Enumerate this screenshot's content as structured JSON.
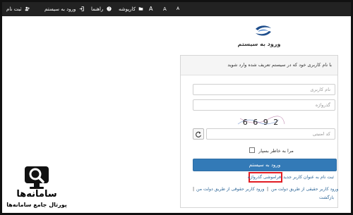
{
  "topbar": {
    "register": "ثبت نام",
    "login": "ورود به سیستم",
    "help": "راهنما",
    "kartabl": "کارپوشه",
    "font_a_1": "A",
    "font_a_2": "A",
    "font_a_3": "A"
  },
  "login": {
    "title": "ورود به سیستم",
    "panel_heading": "با نام کاربری خود که در سیستم تعریف شده وارد شوید",
    "username_placeholder": "نام کاربری",
    "password_placeholder": "گذرواژه",
    "captcha_text": "6 6 9 2",
    "security_code_placeholder": "کد امنیتی",
    "remember_label": "مرا به خاطر بسپار",
    "submit_label": "ورود به سیستم",
    "forgot_password": "فراموشی گذرواژه",
    "register_new_user": "ثبت نام به عنوان کاربر جدید",
    "link_real_user": "ورود کاربر حقیقی از طریق دولت من",
    "link_legal_user": "ورود کاربر حقوقی از طریق دولت من",
    "link_separator": "|",
    "back": "بازگشت"
  },
  "brand": {
    "name": "سامانه‌ها",
    "subtitle": "پورتال جامع سامانه‌ها"
  },
  "colors": {
    "topbar": "#222222",
    "primary": "#337ab7",
    "highlight": "#e11b22"
  }
}
